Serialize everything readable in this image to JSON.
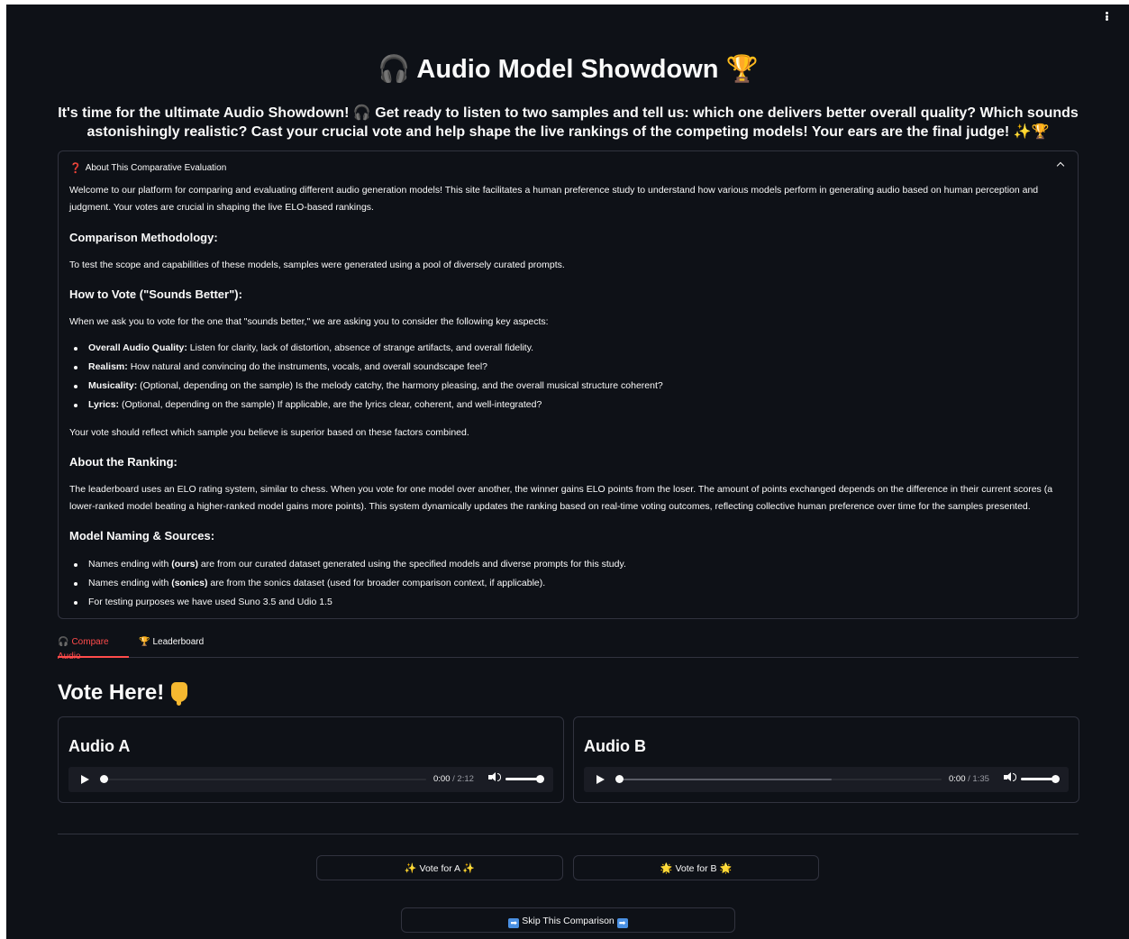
{
  "header": {
    "title_icon": "🎧",
    "title": "Audio Model Showdown",
    "title_trophy": "🏆",
    "subtitle_line1": "It's time for the ultimate Audio Showdown! 🎧 Get ready to listen to two samples and tell us: which one delivers better overall quality? Which sounds",
    "subtitle_line2": "astonishingly realistic? Cast your crucial vote and help shape the live rankings of the competing models! Your ears are the final judge! ✨🏆"
  },
  "about": {
    "header_icon": "❓",
    "header_label": "About This Comparative Evaluation",
    "intro": "Welcome to our platform for comparing and evaluating different audio generation models! This site facilitates a human preference study to understand how various models perform in generating audio based on human perception and judgment. Your votes are crucial in shaping the live ELO-based rankings.",
    "methodology_heading": "Comparison Methodology:",
    "methodology_text": "To test the scope and capabilities of these models, samples were generated using a pool of diversely curated prompts.",
    "howto_heading": "How to Vote (\"Sounds Better\"):",
    "howto_text": "When we ask you to vote for the one that \"sounds better,\" we are asking you to consider the following key aspects:",
    "aspects": [
      {
        "label": "Overall Audio Quality:",
        "text": " Listen for clarity, lack of distortion, absence of strange artifacts, and overall fidelity."
      },
      {
        "label": "Realism:",
        "text": " How natural and convincing do the instruments, vocals, and overall soundscape feel?"
      },
      {
        "label": "Musicality:",
        "text": " (Optional, depending on the sample) Is the melody catchy, the harmony pleasing, and the overall musical structure coherent?"
      },
      {
        "label": "Lyrics:",
        "text": " (Optional, depending on the sample) If applicable, are the lyrics clear, coherent, and well-integrated?"
      }
    ],
    "vote_reflect": "Your vote should reflect which sample you believe is superior based on these factors combined.",
    "ranking_heading": "About the Ranking:",
    "ranking_text": "The leaderboard uses an ELO rating system, similar to chess. When you vote for one model over another, the winner gains ELO points from the loser. The amount of points exchanged depends on the difference in their current scores (a lower-ranked model beating a higher-ranked model gains more points). This system dynamically updates the ranking based on real-time voting outcomes, reflecting collective human preference over time for the samples presented.",
    "naming_heading": "Model Naming & Sources:",
    "naming_items": [
      {
        "pre": "Names ending with ",
        "bold": "(ours)",
        "post": " are from our curated dataset generated using the specified models and diverse prompts for this study."
      },
      {
        "pre": "Names ending with ",
        "bold": "(sonics)",
        "post": " are from the sonics dataset (used for broader comparison context, if applicable)."
      },
      {
        "pre": "For testing purposes we have used Suno 3.5 and Udio 1.5",
        "bold": "",
        "post": ""
      }
    ]
  },
  "tabs": [
    {
      "icon": "🎧",
      "label": "Compare Audio",
      "active": true
    },
    {
      "icon": "🏆",
      "label": "Leaderboard",
      "active": false
    }
  ],
  "vote_heading": "Vote Here!",
  "audio_a": {
    "title": "Audio A",
    "current_time": "0:00",
    "separator": "/",
    "duration": "2:12",
    "progress": 0.0,
    "buffered": 0.0,
    "volume": 1.0
  },
  "audio_b": {
    "title": "Audio B",
    "current_time": "0:00",
    "separator": "/",
    "duration": "1:35",
    "progress": 0.0,
    "buffered": 0.66,
    "volume": 1.0
  },
  "buttons": {
    "vote_a": {
      "left": "✨",
      "label": "Vote for A",
      "right": "✨"
    },
    "vote_b": {
      "left": "🌟",
      "label": "Vote for B",
      "right": "🌟"
    },
    "skip": {
      "left": "➡",
      "label": "Skip This Comparison",
      "right": "➡"
    }
  },
  "colors": {
    "background": "#0e1117",
    "text": "#fafafa",
    "accent": "#ff4b4b",
    "border": "#31333f",
    "player_bg": "#1a1c24"
  }
}
